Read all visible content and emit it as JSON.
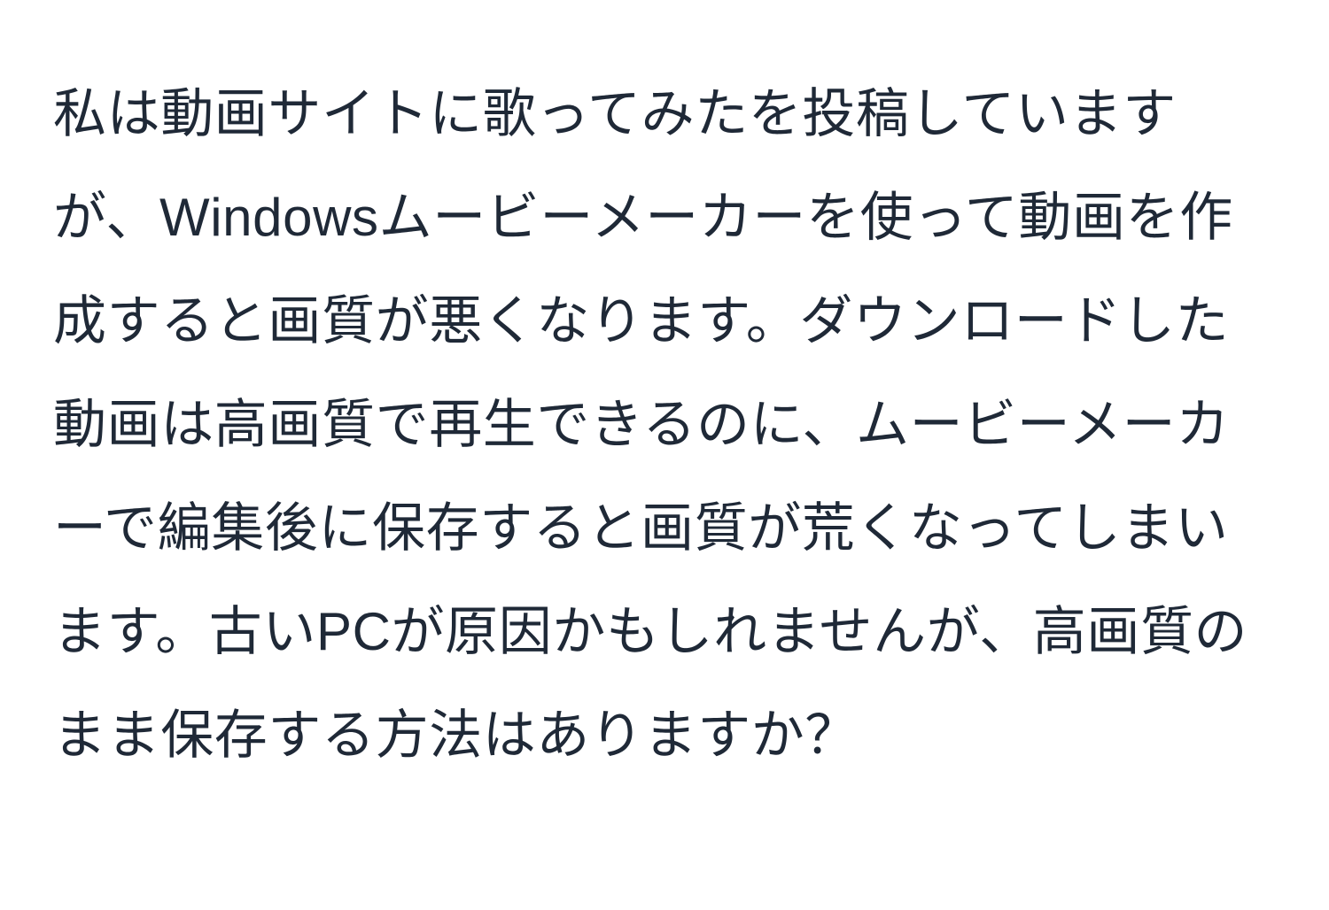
{
  "document": {
    "body_text": "私は動画サイトに歌ってみたを投稿していますが、Windowsムービーメーカーを使って動画を作成すると画質が悪くなります。ダウンロードした動画は高画質で再生できるのに、ムービーメーカーで編集後に保存すると画質が荒くなってしまいます。古いPCが原因かもしれませんが、高画質のまま保存する方法はありますか？"
  }
}
